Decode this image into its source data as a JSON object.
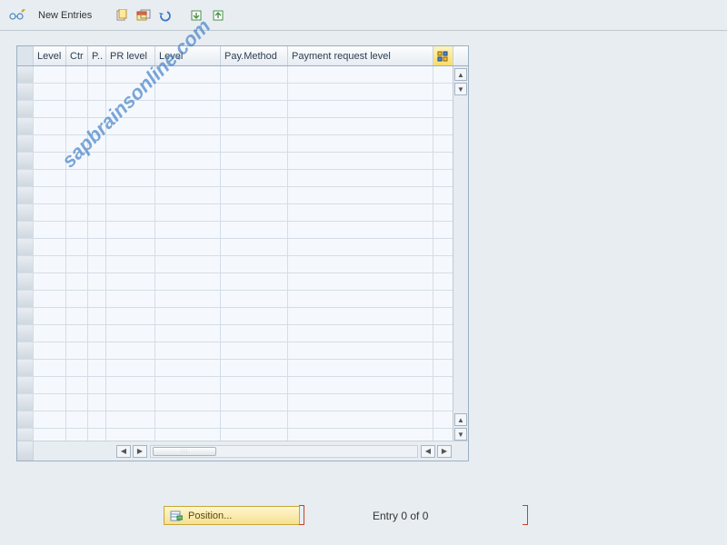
{
  "toolbar": {
    "new_entries_label": "New Entries",
    "icons": {
      "glasses": "glasses-pencil",
      "copy": "copy",
      "copy_all": "copy-with-header",
      "undo": "undo",
      "import": "import",
      "export": "export"
    }
  },
  "table": {
    "headers": {
      "level1": "Level",
      "ctr": "Ctr",
      "p": "P..",
      "prlevel": "PR level",
      "level2": "Level",
      "paymethod": "Pay.Method",
      "payreqlevel": "Payment request level"
    },
    "row_count": 22
  },
  "footer": {
    "position_label": "Position...",
    "entry_label": "Entry 0 of 0"
  },
  "watermark": "sapbrainsonline.com"
}
